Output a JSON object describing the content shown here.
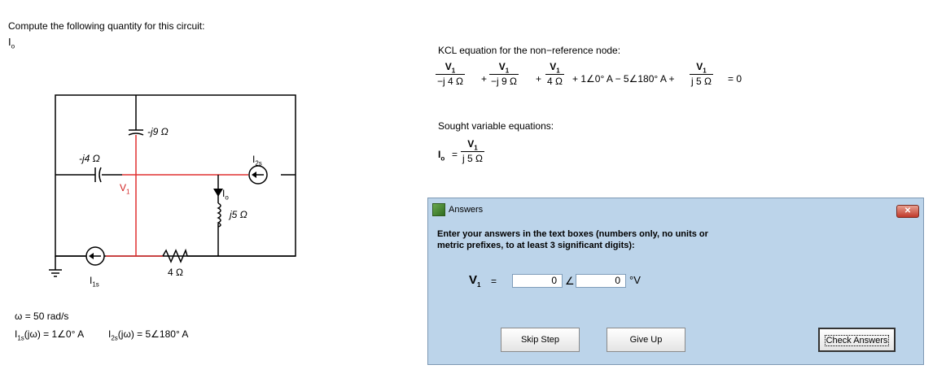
{
  "prompt": {
    "line1": "Compute the following quantity for this circuit:",
    "quantity": "I",
    "quantity_sub": "o"
  },
  "circuit": {
    "cap1_label": "-j4 Ω",
    "cap2_label": "-j9 Ω",
    "ind_label": "j5 Ω",
    "res_label": "4 Ω",
    "node_label": "V",
    "node_sub": "1",
    "io_label": "I",
    "io_sub": "o",
    "src1_label": "I",
    "src1_sub": "1s",
    "src2_label": "I",
    "src2_sub": "2s"
  },
  "givens": {
    "omega": "ω = 50 rad/s",
    "i1s_name": "I",
    "i1s_sub": "1s",
    "i1s_value": "(jω) = 1∠0° A",
    "i2s_name": "I",
    "i2s_sub": "2s",
    "i2s_value": "(jω) = 5∠180° A"
  },
  "kcl": {
    "heading": "KCL equation for the non−reference node:",
    "term1_num": "V",
    "term1_den": "−j 4 Ω",
    "term2_num": "V",
    "term2_den": "−j 9 Ω",
    "term3_num": "V",
    "term3_den": "4 Ω",
    "middle": "+ 1∠0° A − 5∠180° A +",
    "term4_num": "V",
    "term4_den": "j 5 Ω",
    "tail": "= 0",
    "sub": "1"
  },
  "sought": {
    "heading": "Sought variable equations:",
    "lhs": "I",
    "lhs_sub": "o",
    "eq": "=",
    "num": "V",
    "num_sub": "1",
    "den": "j 5 Ω"
  },
  "dialog": {
    "title": "Answers",
    "instructions": "Enter your answers in the text boxes (numbers only, no units or metric prefixes, to at least 3 significant digits):",
    "var": "V",
    "var_sub": "1",
    "eq": "=",
    "mag_value": "0",
    "angle_symbol": "∠",
    "angle_value": "0",
    "unit": "°V",
    "skip_label": "Skip Step",
    "giveup_label": "Give Up",
    "check_label": "Check Answers",
    "close_symbol": "✕"
  }
}
